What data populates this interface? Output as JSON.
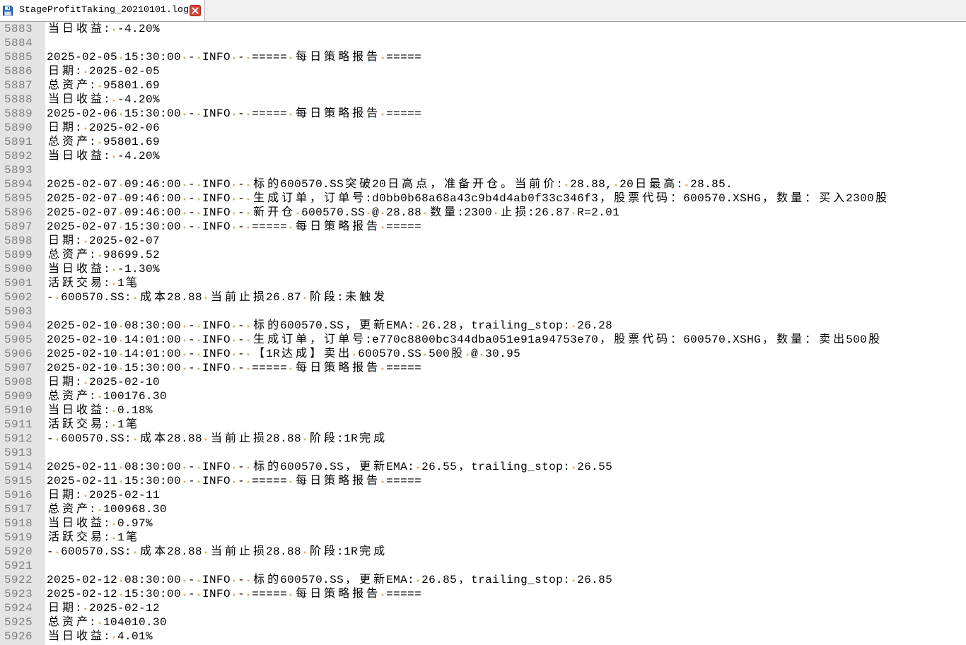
{
  "window": {
    "tabs": [
      {
        "label": "StageProfitTaking_20210101.log",
        "icon": "saved-file-icon",
        "close_icon": "close-icon",
        "active": true
      }
    ]
  },
  "editor": {
    "lines": [
      {
        "n": "5883",
        "text": "当日收益: -4.20%"
      },
      {
        "n": "5884",
        "text": ""
      },
      {
        "n": "5885",
        "text": "2025-02-05 15:30:00 - INFO - ===== 每日策略报告 ====="
      },
      {
        "n": "5886",
        "text": "日期: 2025-02-05"
      },
      {
        "n": "5887",
        "text": "总资产: 95801.69"
      },
      {
        "n": "5888",
        "text": "当日收益: -4.20%"
      },
      {
        "n": "5889",
        "text": "2025-02-06 15:30:00 - INFO - ===== 每日策略报告 ====="
      },
      {
        "n": "5890",
        "text": "日期: 2025-02-06"
      },
      {
        "n": "5891",
        "text": "总资产: 95801.69"
      },
      {
        "n": "5892",
        "text": "当日收益: -4.20%"
      },
      {
        "n": "5893",
        "text": ""
      },
      {
        "n": "5894",
        "text": "2025-02-07 09:46:00 - INFO - 标的600570.SS突破20日高点，准备开仓。当前价: 28.88, 20日最高: 28.85."
      },
      {
        "n": "5895",
        "text": "2025-02-07 09:46:00 - INFO - 生成订单，订单号:d0bb0b68a68a43c9b4d4ab0f33c346f3，股票代码：600570.XSHG，数量：买入2300股"
      },
      {
        "n": "5896",
        "text": "2025-02-07 09:46:00 - INFO - 新开仓 600570.SS @ 28.88 数量:2300 止损:26.87 R=2.01"
      },
      {
        "n": "5897",
        "text": "2025-02-07 15:30:00 - INFO - ===== 每日策略报告 ====="
      },
      {
        "n": "5898",
        "text": "日期: 2025-02-07"
      },
      {
        "n": "5899",
        "text": "总资产: 98699.52"
      },
      {
        "n": "5900",
        "text": "当日收益: -1.30%"
      },
      {
        "n": "5901",
        "text": "活跃交易: 1笔"
      },
      {
        "n": "5902",
        "text": "- 600570.SS: 成本28.88 当前止损26.87 阶段:未触发"
      },
      {
        "n": "5903",
        "text": ""
      },
      {
        "n": "5904",
        "text": "2025-02-10 08:30:00 - INFO - 标的600570.SS，更新EMA: 26.28，trailing_stop: 26.28"
      },
      {
        "n": "5905",
        "text": "2025-02-10 14:01:00 - INFO - 生成订单，订单号:e770c8800bc344dba051e91a94753e70，股票代码：600570.XSHG，数量：卖出500股"
      },
      {
        "n": "5906",
        "text": "2025-02-10 14:01:00 - INFO - 【1R达成】卖出 600570.SS 500股 @ 30.95"
      },
      {
        "n": "5907",
        "text": "2025-02-10 15:30:00 - INFO - ===== 每日策略报告 ====="
      },
      {
        "n": "5908",
        "text": "日期: 2025-02-10"
      },
      {
        "n": "5909",
        "text": "总资产: 100176.30"
      },
      {
        "n": "5910",
        "text": "当日收益: 0.18%"
      },
      {
        "n": "5911",
        "text": "活跃交易: 1笔"
      },
      {
        "n": "5912",
        "text": "- 600570.SS: 成本28.88 当前止损28.88 阶段:1R完成"
      },
      {
        "n": "5913",
        "text": ""
      },
      {
        "n": "5914",
        "text": "2025-02-11 08:30:00 - INFO - 标的600570.SS，更新EMA: 26.55，trailing_stop: 26.55"
      },
      {
        "n": "5915",
        "text": "2025-02-11 15:30:00 - INFO - ===== 每日策略报告 ====="
      },
      {
        "n": "5916",
        "text": "日期: 2025-02-11"
      },
      {
        "n": "5917",
        "text": "总资产: 100968.30"
      },
      {
        "n": "5918",
        "text": "当日收益: 0.97%"
      },
      {
        "n": "5919",
        "text": "活跃交易: 1笔"
      },
      {
        "n": "5920",
        "text": "- 600570.SS: 成本28.88 当前止损28.88 阶段:1R完成"
      },
      {
        "n": "5921",
        "text": ""
      },
      {
        "n": "5922",
        "text": "2025-02-12 08:30:00 - INFO - 标的600570.SS，更新EMA: 26.85，trailing_stop: 26.85"
      },
      {
        "n": "5923",
        "text": "2025-02-12 15:30:00 - INFO - ===== 每日策略报告 ====="
      },
      {
        "n": "5924",
        "text": "日期: 2025-02-12"
      },
      {
        "n": "5925",
        "text": "总资产: 104010.30"
      },
      {
        "n": "5926",
        "text": "当日收益: 4.01%"
      }
    ]
  },
  "colors": {
    "tabbar_bg": "#f0f0f0",
    "gutter_bg": "#e4e4e4",
    "line_number": "#808080",
    "whitespace_marker": "#f2a064",
    "close_button": "#d9453b",
    "save_icon": "#2f6fc9"
  }
}
